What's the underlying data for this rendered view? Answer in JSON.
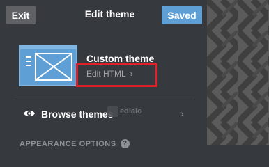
{
  "header": {
    "exit_label": "Exit",
    "title": "Edit theme",
    "saved_label": "Saved"
  },
  "theme": {
    "name": "Custom theme",
    "edit_html_label": "Edit HTML",
    "edit_html_chevron": "›"
  },
  "browse": {
    "label": "Browse themes",
    "chevron": "›",
    "watermark_text": "ediaio"
  },
  "appearance": {
    "label": "APPEARANCE OPTIONS",
    "help_glyph": "?"
  },
  "colors": {
    "panel_bg": "#36393e",
    "accent": "#5e9fd6",
    "highlight": "#e0202a"
  }
}
